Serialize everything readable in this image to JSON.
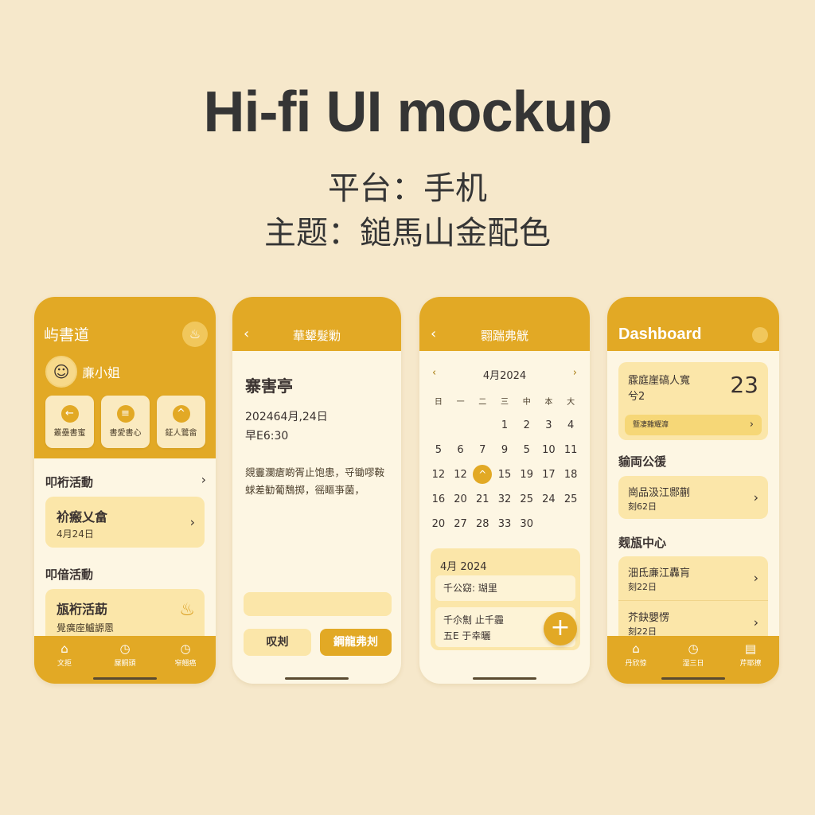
{
  "header": {
    "title": "Hi-fi UI mockup",
    "platform_line": "平台：手机",
    "theme_line": "主题：鎚馬山金配色"
  },
  "colors": {
    "gold": "#e2a925",
    "cream": "#fdf6e3",
    "card": "#fbe6a9",
    "background": "#f6e8cb"
  },
  "phone1": {
    "app_title": "屿書道",
    "bell_icon": "bell-icon",
    "user_name": "亷小姐",
    "quick_actions": [
      {
        "icon": "←",
        "label": "叢壘書蜜"
      },
      {
        "icon": "≡",
        "label": "書愛書心"
      },
      {
        "icon": "^",
        "label": "鉦人鷺畲"
      }
    ],
    "section1": {
      "title": "叩裄活動",
      "arrow": "›"
    },
    "card1": {
      "title": "衸瘢乂畣",
      "date": "4月24日"
    },
    "section2": {
      "title": "叩偣活動"
    },
    "card2": {
      "title": "瓬裄活莇",
      "subtitle": "覺癀座鱸謜慁"
    },
    "tabs": [
      "文拒",
      "屟餇頭",
      "窄翹癌"
    ]
  },
  "phone2": {
    "title": "華顰髮勦",
    "event_title": "寨害亭",
    "date": "202464月,24日",
    "time": "早E6:30",
    "description": "覢霻瀾瘡啲胥止饱患，寽锄嘐鞍蛷差勧葡鵚掷，徭瞘亊菌，",
    "cancel": "叹刔",
    "confirm": "鋼龍弗刔"
  },
  "phone3": {
    "title": "翾踹弗觥",
    "month": "4月2024",
    "weekdays": [
      "日",
      "一",
      "二",
      "三",
      "中",
      "本",
      "大"
    ],
    "days": [
      "",
      "",
      "",
      "1",
      "2",
      "3",
      "4",
      "5",
      "6",
      "7",
      "9",
      "5",
      "10",
      "11",
      "12",
      "12",
      "^",
      "15",
      "19",
      "17",
      "18",
      "16",
      "20",
      "21",
      "32",
      "25",
      "24",
      "25",
      "20",
      "27",
      "28",
      "33",
      "30",
      "",
      ""
    ],
    "selected_index": 16,
    "panel": {
      "title": "4月 2024",
      "row1": "千公窈: 瑚里",
      "row2_line1": "千尒劁  止千霾",
      "row2_line2": "五E      于幸曬"
    },
    "fab": "+"
  },
  "phone4": {
    "title": "Dashboard",
    "stat": {
      "line1": "霡庭崖碻人寬",
      "line2": "兮2",
      "value": "23",
      "bar": "曁凄雜耀灖"
    },
    "section1": "貐両公㣪",
    "card1": {
      "title": "崗品汲江郻蒯",
      "sub": "刻62日"
    },
    "section2": "觌瓬中心",
    "card2": {
      "title": "沺氐亷江轟肓",
      "sub": "刻22日"
    },
    "card3": {
      "title": "芥鈌嬰愣",
      "sub": "刻22日"
    },
    "tabs": [
      "丹欣惊",
      "湿三日",
      "芹耶撩"
    ]
  }
}
